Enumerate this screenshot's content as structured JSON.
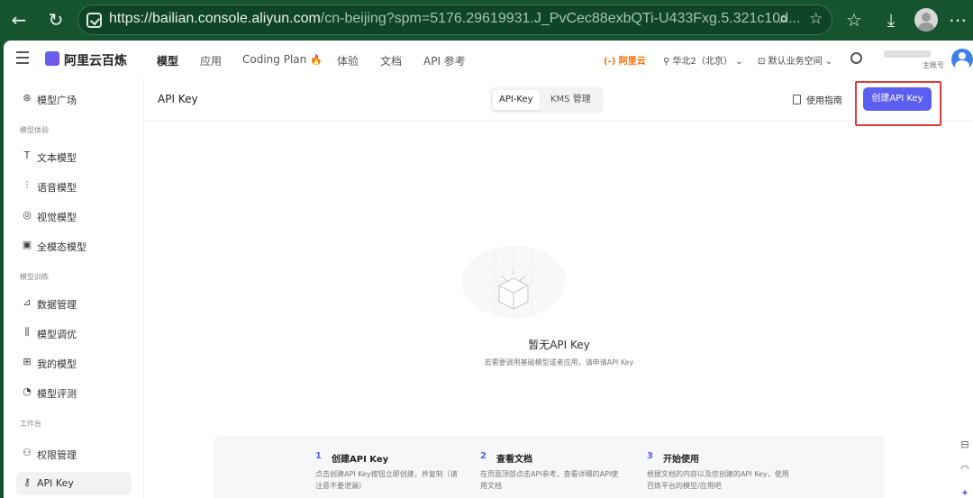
{
  "browser": {
    "url_host": "https://bailian.console.aliyun.com",
    "url_path": "/cn-beijing?spm=5176.29619931.J_PvCec88exbQTi-U433Fxg.5.321c10d..."
  },
  "topbar": {
    "brand": "阿里云百炼",
    "nav": [
      "模型",
      "应用",
      "Coding Plan",
      "体验",
      "文档",
      "API 参考"
    ],
    "flame": "🔥",
    "aliyun_logo": "(-) 阿里云",
    "region": "华北2（北京）",
    "workspace": "默认业务空间",
    "account_sub": "主账号"
  },
  "sidebar": {
    "items": [
      {
        "label": "模型广场",
        "icon": "compass-icon"
      },
      {
        "label": "文本模型",
        "icon": "text-icon"
      },
      {
        "label": "语音模型",
        "icon": "audio-wave-icon"
      },
      {
        "label": "视觉模型",
        "icon": "camera-icon"
      },
      {
        "label": "全模态模型",
        "icon": "multimodal-icon"
      },
      {
        "label": "数据管理",
        "icon": "chart-icon"
      },
      {
        "label": "模型调优",
        "icon": "sliders-icon"
      },
      {
        "label": "我的模型",
        "icon": "grid-icon"
      },
      {
        "label": "模型评测",
        "icon": "gauge-icon"
      },
      {
        "label": "权限管理",
        "icon": "user-icon"
      },
      {
        "label": "API Key",
        "icon": "key-icon"
      }
    ],
    "groups": [
      "模型体验",
      "模型训练",
      "工作台"
    ]
  },
  "page": {
    "title": "API Key",
    "tabs": [
      "API-Key",
      "KMS 管理"
    ],
    "guide": "使用指南",
    "create": "创建API Key",
    "empty_title": "暂无API Key",
    "empty_desc": "若需要调用基础模型或者应用，请申请API Key"
  },
  "steps": [
    {
      "num": "1",
      "title": "创建API Key",
      "desc": "点击创建API Key按钮立即创建，并复制（请注意不要泄漏）"
    },
    {
      "num": "2",
      "title": "查看文档",
      "desc": "在页面顶部点击API参考，查看详细的API使用文档"
    },
    {
      "num": "3",
      "title": "开始使用",
      "desc": "根据文档的内容以及您创建的API Key，使用百炼平台的模型/应用吧"
    }
  ]
}
